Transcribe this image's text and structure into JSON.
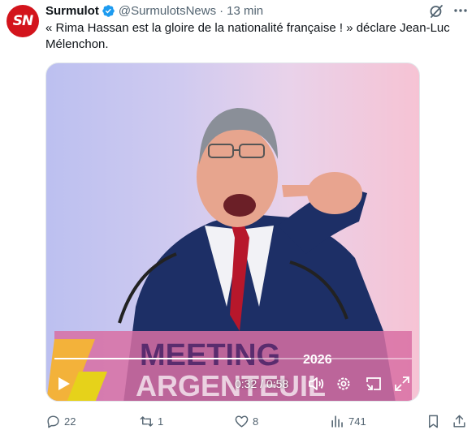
{
  "author": {
    "avatar_text": "SN",
    "name": "Surmulot",
    "handle": "@SurmulotsNews",
    "separator": "·",
    "time": "13 min"
  },
  "tweet": {
    "text": "« Rima Hassan est la gloire de la nationalité française ! » déclare Jean-Luc Mélenchon."
  },
  "video": {
    "banner_text_top": "MEETING",
    "banner_text_bottom": "ARGENTEUIL",
    "banner_year": "2026",
    "current_time": "0:32",
    "time_separator": "/",
    "duration": "0:58",
    "progress": 0.55
  },
  "actions": {
    "replies": "22",
    "reposts": "1",
    "likes": "8",
    "views": "741"
  },
  "colors": {
    "accent": "#1d9bf0",
    "brand_red": "#d3141c",
    "muted": "#536471"
  }
}
